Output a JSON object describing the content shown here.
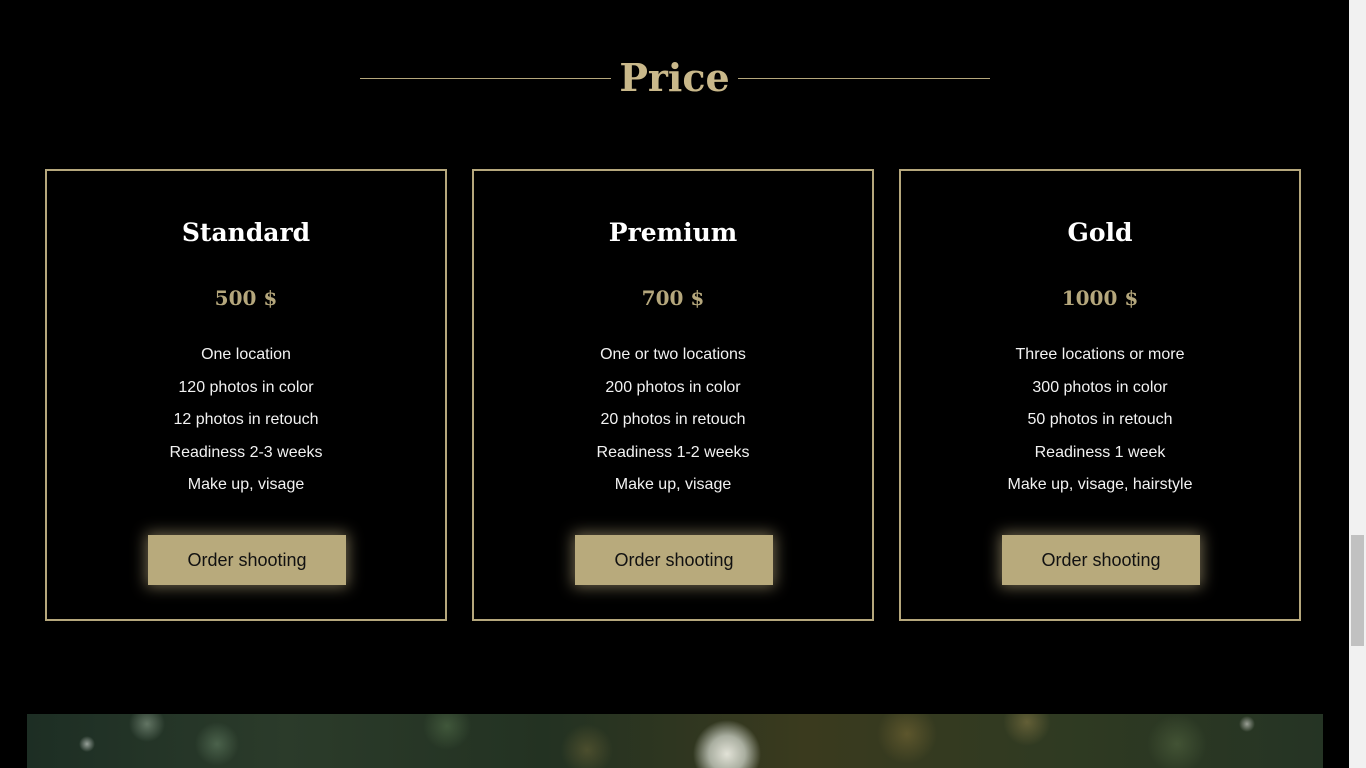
{
  "section": {
    "title": "Price"
  },
  "plans": [
    {
      "name": "Standard",
      "price": "500 $",
      "features": [
        "One location",
        "120 photos in color",
        "12 photos in retouch",
        "Readiness 2-3 weeks",
        "Make up, visage"
      ],
      "button_label": "Order shooting"
    },
    {
      "name": "Premium",
      "price": "700 $",
      "features": [
        "One or two locations",
        "200 photos in color",
        "20 photos in retouch",
        "Readiness 1-2 weeks",
        "Make up, visage"
      ],
      "button_label": "Order shooting"
    },
    {
      "name": "Gold",
      "price": "1000 $",
      "features": [
        "Three locations or more",
        "300 photos in color",
        "50 photos in retouch",
        "Readiness 1 week",
        "Make up, visage, hairstyle"
      ],
      "button_label": "Order shooting"
    }
  ],
  "colors": {
    "background": "#000000",
    "accent": "#b5a77c",
    "button": "#b8aa7c",
    "text": "#ffffff"
  }
}
